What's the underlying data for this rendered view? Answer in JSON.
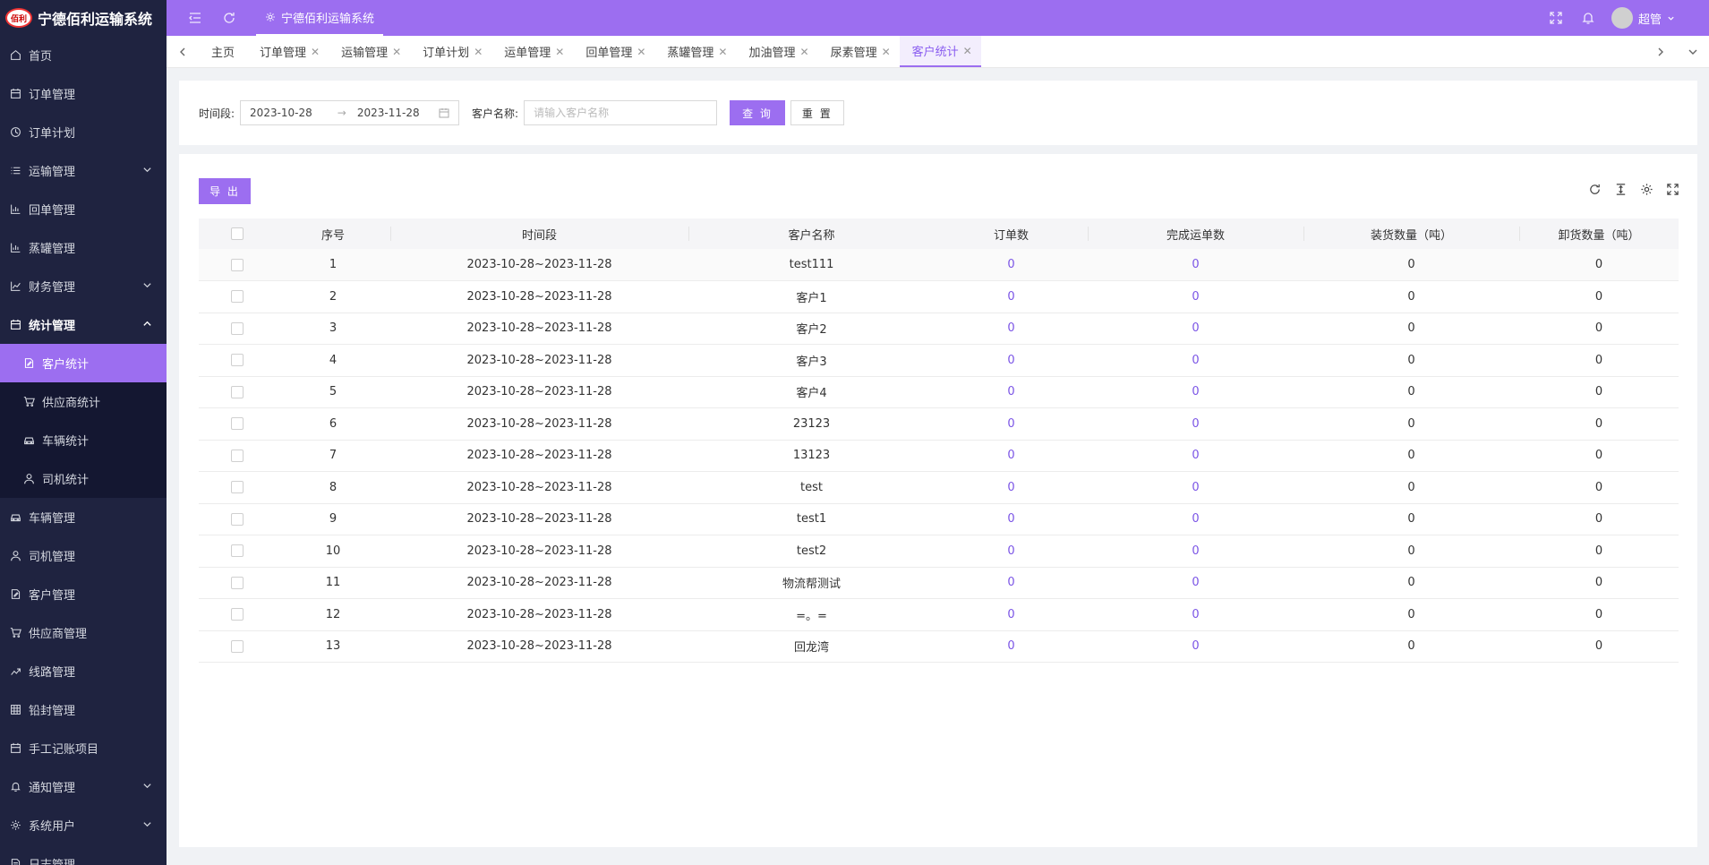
{
  "app": {
    "logo_text": "佰利",
    "title": "宁德佰利运输系统"
  },
  "topbar": {
    "active_tab": "宁德佰利运输系统",
    "user": "超管"
  },
  "sidebar": {
    "items": [
      {
        "label": "首页",
        "icon": "home-icon"
      },
      {
        "label": "订单管理",
        "icon": "calendar-icon"
      },
      {
        "label": "订单计划",
        "icon": "clock-icon"
      },
      {
        "label": "运输管理",
        "icon": "list-icon",
        "expandable": true
      },
      {
        "label": "回单管理",
        "icon": "bar-chart-icon"
      },
      {
        "label": "蒸罐管理",
        "icon": "bar-chart-icon"
      },
      {
        "label": "财务管理",
        "icon": "line-chart-icon",
        "expandable": true
      },
      {
        "label": "统计管理",
        "icon": "calendar-icon",
        "expanded": true
      }
    ],
    "sub_items": [
      {
        "label": "客户统计",
        "icon": "edit-doc-icon",
        "active": true
      },
      {
        "label": "供应商统计",
        "icon": "cart-icon"
      },
      {
        "label": "车辆统计",
        "icon": "car-icon"
      },
      {
        "label": "司机统计",
        "icon": "user-icon"
      }
    ],
    "items_after": [
      {
        "label": "车辆管理",
        "icon": "car-icon"
      },
      {
        "label": "司机管理",
        "icon": "user-icon"
      },
      {
        "label": "客户管理",
        "icon": "edit-doc-icon"
      },
      {
        "label": "供应商管理",
        "icon": "cart-icon"
      },
      {
        "label": "线路管理",
        "icon": "trend-icon"
      },
      {
        "label": "铅封管理",
        "icon": "grid-icon"
      },
      {
        "label": "手工记账项目",
        "icon": "calendar-icon"
      },
      {
        "label": "通知管理",
        "icon": "bell-icon",
        "expandable": true
      },
      {
        "label": "系统用户",
        "icon": "gear-icon",
        "expandable": true
      },
      {
        "label": "日志管理",
        "icon": "doc-icon"
      }
    ]
  },
  "tabs": [
    {
      "label": "主页",
      "closable": false
    },
    {
      "label": "订单管理",
      "closable": true
    },
    {
      "label": "运输管理",
      "closable": true
    },
    {
      "label": "订单计划",
      "closable": true
    },
    {
      "label": "运单管理",
      "closable": true
    },
    {
      "label": "回单管理",
      "closable": true
    },
    {
      "label": "蒸罐管理",
      "closable": true
    },
    {
      "label": "加油管理",
      "closable": true
    },
    {
      "label": "尿素管理",
      "closable": true
    },
    {
      "label": "客户统计",
      "closable": true,
      "active": true
    }
  ],
  "filter": {
    "period_label": "时间段:",
    "start_date": "2023-10-28",
    "end_date": "2023-11-28",
    "range_arrow": "→",
    "customer_label": "客户名称:",
    "customer_placeholder": "请输入客户名称",
    "customer_value": "",
    "query_label": "查 询",
    "reset_label": "重 置"
  },
  "toolbar": {
    "export_label": "导 出"
  },
  "table": {
    "columns": [
      "序号",
      "时间段",
      "客户名称",
      "订单数",
      "完成运单数",
      "装货数量（吨）",
      "卸货数量（吨）"
    ],
    "rows": [
      [
        "1",
        "2023-10-28~2023-11-28",
        "test111",
        "0",
        "0",
        "0",
        "0"
      ],
      [
        "2",
        "2023-10-28~2023-11-28",
        "客户1",
        "0",
        "0",
        "0",
        "0"
      ],
      [
        "3",
        "2023-10-28~2023-11-28",
        "客户2",
        "0",
        "0",
        "0",
        "0"
      ],
      [
        "4",
        "2023-10-28~2023-11-28",
        "客户3",
        "0",
        "0",
        "0",
        "0"
      ],
      [
        "5",
        "2023-10-28~2023-11-28",
        "客户4",
        "0",
        "0",
        "0",
        "0"
      ],
      [
        "6",
        "2023-10-28~2023-11-28",
        "23123",
        "0",
        "0",
        "0",
        "0"
      ],
      [
        "7",
        "2023-10-28~2023-11-28",
        "13123",
        "0",
        "0",
        "0",
        "0"
      ],
      [
        "8",
        "2023-10-28~2023-11-28",
        "test",
        "0",
        "0",
        "0",
        "0"
      ],
      [
        "9",
        "2023-10-28~2023-11-28",
        "test1",
        "0",
        "0",
        "0",
        "0"
      ],
      [
        "10",
        "2023-10-28~2023-11-28",
        "test2",
        "0",
        "0",
        "0",
        "0"
      ],
      [
        "11",
        "2023-10-28~2023-11-28",
        "物流帮测试",
        "0",
        "0",
        "0",
        "0"
      ],
      [
        "12",
        "2023-10-28~2023-11-28",
        "=。=",
        "0",
        "0",
        "0",
        "0"
      ],
      [
        "13",
        "2023-10-28~2023-11-28",
        "回龙湾",
        "0",
        "0",
        "0",
        "0"
      ]
    ]
  },
  "colors": {
    "accent": "#9c6ef0",
    "sidebar_bg": "#1f2340",
    "link": "#7b55e6"
  }
}
